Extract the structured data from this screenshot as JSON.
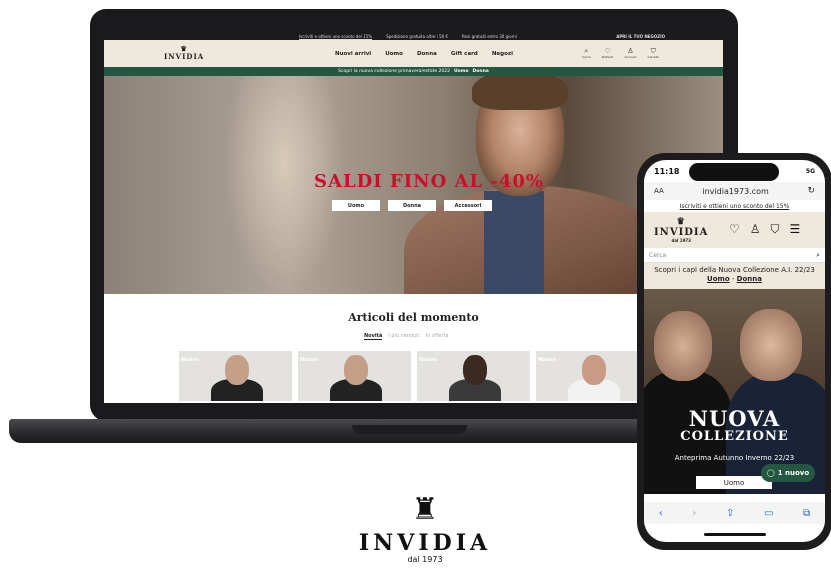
{
  "desktop": {
    "topbar": {
      "items": [
        "Iscriviti e ottieni uno sconto del 15%",
        "Spedizione gratuita oltre i 50 €",
        "Resi gratuiti entro 30 giorni"
      ],
      "right": "APRI IL TUO NEGOZIO"
    },
    "nav": {
      "logo": "INVIDIA",
      "links": [
        "Nuovi arrivi",
        "Uomo",
        "Donna",
        "Gift card",
        "Negozi"
      ],
      "icons": [
        "Cerca",
        "Preferiti",
        "Account",
        "Carrello"
      ]
    },
    "promo": {
      "text": "Scopri la nuova collezione primavera/estate 2022",
      "link1": "Uomo",
      "link2": "Donna"
    },
    "hero": {
      "headline": "SALDI FINO AL -40%",
      "buttons": [
        "Uomo",
        "Donna",
        "Accessori"
      ]
    },
    "section": {
      "title": "Articoli del momento",
      "tabs": [
        "Novità",
        "I più venduti",
        "In offerta"
      ],
      "cards": [
        "Nuovo",
        "Nuovo",
        "Nuovo",
        "Nuovo"
      ]
    }
  },
  "phone": {
    "status": {
      "time": "11:18",
      "battery": "5G"
    },
    "url": {
      "aa": "AA",
      "address": "invidia1973.com"
    },
    "promo": "Iscriviti e ottieni uno sconto del 15%",
    "logo": "INVIDIA",
    "logo_sub": "dal 1973",
    "search_placeholder": "Cerca",
    "promo2": {
      "text": "Scopri i capi della Nuova Collezione A.I. 22/23",
      "link1": "Uomo",
      "link2": "Donna"
    },
    "hero": {
      "line1": "NUOVA",
      "line2": "COLLEZIONE",
      "sub": "Anteprima Autunno Inverno 22/23",
      "button": "Uomo"
    },
    "chat": "1 nuovo"
  },
  "brand": {
    "name": "INVIDIA",
    "since": "dal 1973"
  }
}
